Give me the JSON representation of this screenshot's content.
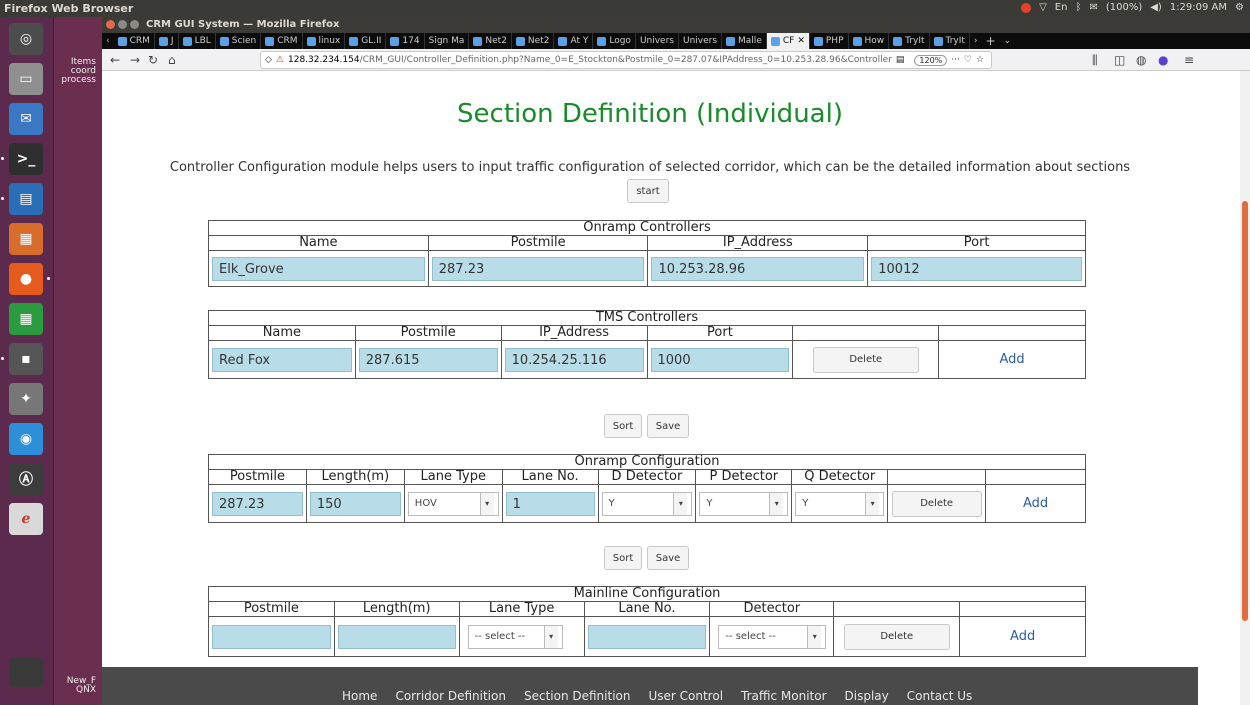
{
  "os": {
    "panel_title": "Firefox Web Browser",
    "tray_lang": "En",
    "tray_battery": "(100%)",
    "tray_time": "1:29:09 AM"
  },
  "desktop": {
    "top_label_1": "Items",
    "top_label_2": "coord",
    "top_label_3": "process",
    "bottom_label_1": "New_F",
    "bottom_label_2": "QNX"
  },
  "browser": {
    "window_title": "CRM GUI System — Mozilla Firefox",
    "tabs": [
      "CRM",
      "J",
      "LBL",
      "Scien",
      "CRM",
      "linux",
      "GL.II",
      "174",
      "Sign Ma",
      "Net2",
      "Net2",
      "At Y",
      "Logo",
      "Univers",
      "Univers",
      "Malle",
      "CF",
      "PHP",
      "How",
      "TryIt",
      "TryIt"
    ],
    "url_host": "128.32.234.154",
    "url_path": "/CRM_GUI/Controller_Definition.php?Name_0=E_Stockton&Postmile_0=287.07&IPAddress_0=10.253.28.96&Controller",
    "zoom": "120%"
  },
  "page": {
    "title": "Section Definition (Individual)",
    "description": "Controller Configuration module helps users to input traffic configuration of selected corridor, which can be the detailed information about sections",
    "start_label": "start",
    "sort_label": "Sort",
    "save_label": "Save",
    "delete_label": "Delete",
    "add_label": "Add"
  },
  "onramp_controllers": {
    "caption": "Onramp Controllers",
    "headers": [
      "Name",
      "Postmile",
      "IP_Address",
      "Port"
    ],
    "row": [
      "Elk_Grove",
      "287.23",
      "10.253.28.96",
      "10012"
    ]
  },
  "tms_controllers": {
    "caption": "TMS Controllers",
    "headers": [
      "Name",
      "Postmile",
      "IP_Address",
      "Port"
    ],
    "row": [
      "Red Fox",
      "287.615",
      "10.254.25.116",
      "1000"
    ]
  },
  "onramp_configuration": {
    "caption": "Onramp Configuration",
    "headers": [
      "Postmile",
      "Length(m)",
      "Lane Type",
      "Lane No.",
      "D Detector",
      "P Detector",
      "Q Detector"
    ],
    "row": [
      "287.23",
      "150",
      "HOV",
      "1",
      "Y",
      "Y",
      "Y"
    ]
  },
  "mainline_configuration": {
    "caption": "Mainline Configuration",
    "headers": [
      "Postmile",
      "Length(m)",
      "Lane Type",
      "Lane No.",
      "Detector"
    ],
    "select_placeholder": "-- select --"
  },
  "footer": {
    "links": [
      "Home",
      "Corridor Definition",
      "Section Definition",
      "User Control",
      "Traffic Monitor",
      "Display",
      "Contact Us"
    ]
  }
}
